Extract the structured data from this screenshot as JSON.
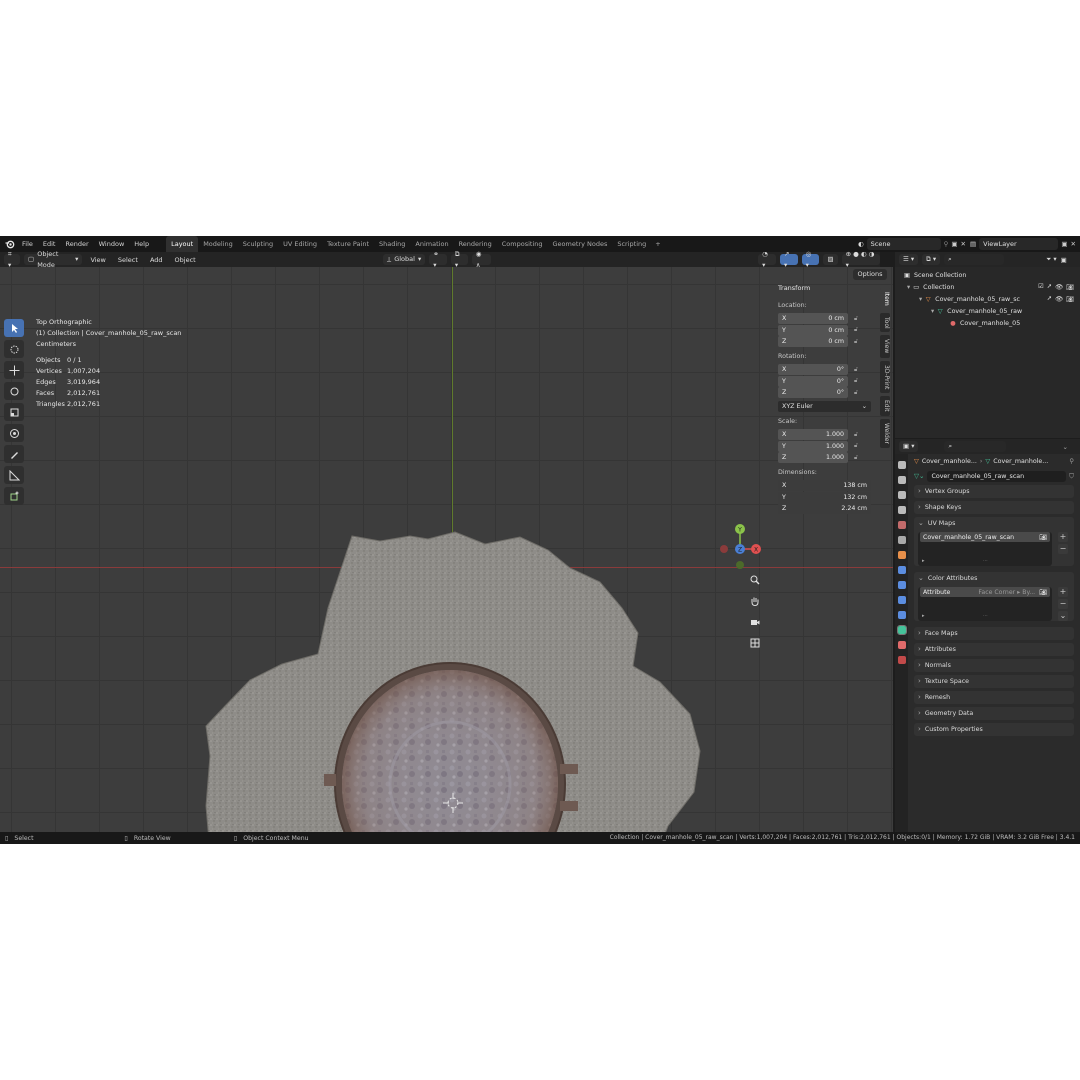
{
  "menu": [
    "File",
    "Edit",
    "Render",
    "Window",
    "Help"
  ],
  "workspaces": [
    {
      "label": "Layout",
      "active": true
    },
    {
      "label": "Modeling",
      "active": false
    },
    {
      "label": "Sculpting",
      "active": false
    },
    {
      "label": "UV Editing",
      "active": false
    },
    {
      "label": "Texture Paint",
      "active": false
    },
    {
      "label": "Shading",
      "active": false
    },
    {
      "label": "Animation",
      "active": false
    },
    {
      "label": "Rendering",
      "active": false
    },
    {
      "label": "Compositing",
      "active": false
    },
    {
      "label": "Geometry Nodes",
      "active": false
    },
    {
      "label": "Scripting",
      "active": false
    }
  ],
  "workspace_add": "+",
  "scene": "Scene",
  "view_layer": "ViewLayer",
  "viewport_header": {
    "mode": "Object Mode",
    "menus": [
      "View",
      "Select",
      "Add",
      "Object"
    ],
    "orientation": "Global",
    "options": "Options"
  },
  "viewport_overlay": {
    "view_name": "Top Orthographic",
    "collection_line": "(1) Collection | Cover_manhole_05_raw_scan",
    "units": "Centimeters",
    "stats": [
      {
        "label": "Objects",
        "value": "0 / 1"
      },
      {
        "label": "Vertices",
        "value": "1,007,204"
      },
      {
        "label": "Edges",
        "value": "3,019,964"
      },
      {
        "label": "Faces",
        "value": "2,012,761"
      },
      {
        "label": "Triangles",
        "value": "2,012,761"
      }
    ]
  },
  "gizmo": {
    "x": "X",
    "y": "Y",
    "z": "Z"
  },
  "transform": {
    "title": "Transform",
    "location_label": "Location:",
    "location": [
      {
        "axis": "X",
        "value": "0 cm"
      },
      {
        "axis": "Y",
        "value": "0 cm"
      },
      {
        "axis": "Z",
        "value": "0 cm"
      }
    ],
    "rotation_label": "Rotation:",
    "rotation": [
      {
        "axis": "X",
        "value": "0°"
      },
      {
        "axis": "Y",
        "value": "0°"
      },
      {
        "axis": "Z",
        "value": "0°"
      }
    ],
    "rotation_mode": "XYZ Euler",
    "scale_label": "Scale:",
    "scale": [
      {
        "axis": "X",
        "value": "1.000"
      },
      {
        "axis": "Y",
        "value": "1.000"
      },
      {
        "axis": "Z",
        "value": "1.000"
      }
    ],
    "dimensions_label": "Dimensions:",
    "dimensions": [
      {
        "axis": "X",
        "value": "138 cm"
      },
      {
        "axis": "Y",
        "value": "132 cm"
      },
      {
        "axis": "Z",
        "value": "2.24 cm"
      }
    ]
  },
  "sidebar_tabs": [
    "Item",
    "Tool",
    "View",
    "3D-Print",
    "Edit",
    "Welder"
  ],
  "outliner": {
    "scene_collection": "Scene Collection",
    "collection": "Collection",
    "object": "Cover_manhole_05_raw_sc",
    "mesh": "Cover_manhole_05_raw",
    "material": "Cover_manhole_05"
  },
  "properties": {
    "crumb_object": "Cover_manhole...",
    "crumb_mesh": "Cover_manhole...",
    "mesh_name": "Cover_manhole_05_raw_scan",
    "panels_top": [
      "Vertex Groups",
      "Shape Keys"
    ],
    "uv_maps_title": "UV Maps",
    "uv_map_item": "Cover_manhole_05_raw_scan",
    "color_attr_title": "Color Attributes",
    "color_attr_item": "Attribute",
    "color_attr_domain": "Face Corner ▸ By...",
    "panels_bottom": [
      "Face Maps",
      "Attributes",
      "Normals",
      "Texture Space",
      "Remesh",
      "Geometry Data",
      "Custom Properties"
    ]
  },
  "statusbar": {
    "select": "Select",
    "rotate": "Rotate View",
    "context": "Object Context Menu",
    "info": "Collection | Cover_manhole_05_raw_scan | Verts:1,007,204 | Faces:2,012,761 | Tris:2,012,761 | Objects:0/1 | Memory: 1.72 GiB | VRAM: 3.2 GiB Free | 3.4.1"
  }
}
